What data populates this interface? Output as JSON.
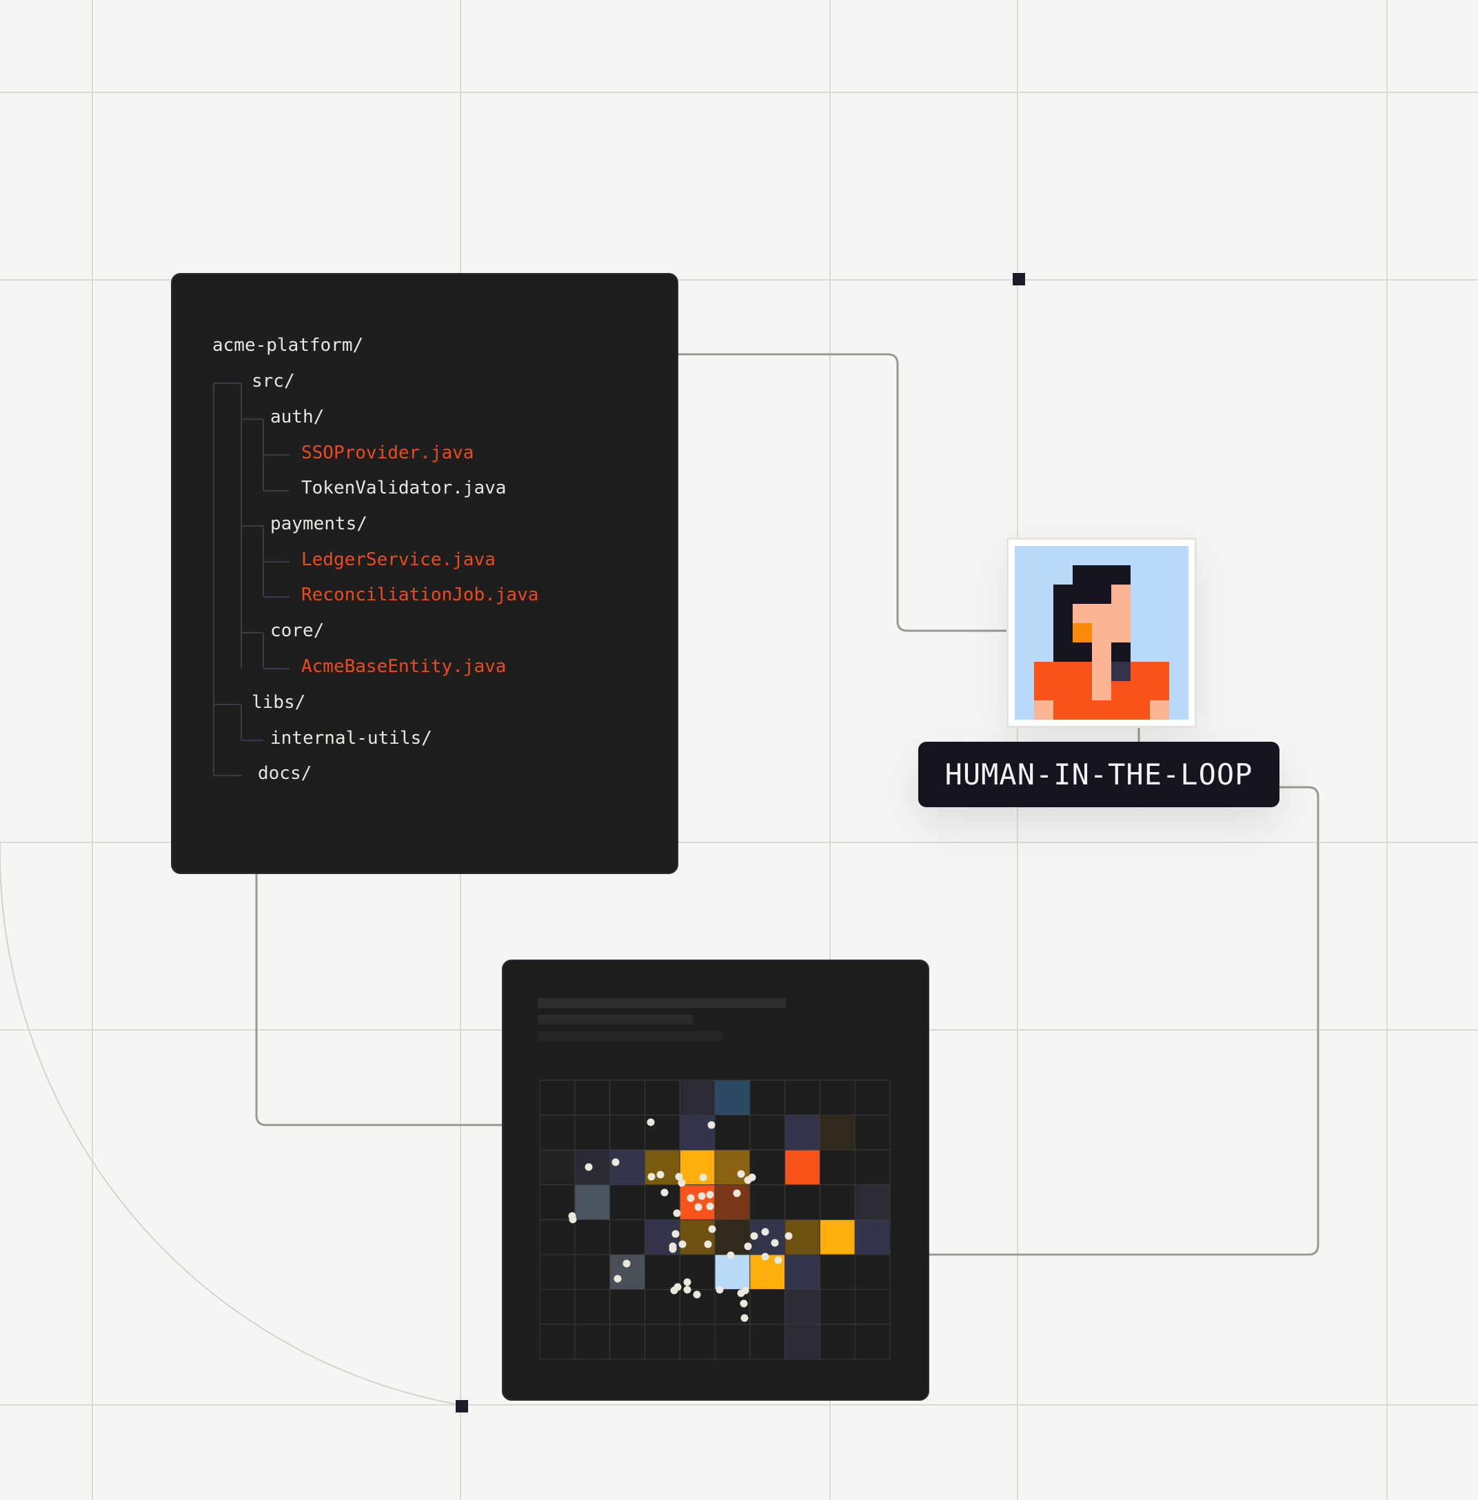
{
  "file_tree": {
    "rows": [
      {
        "label": "acme-platform/",
        "kind": "dir"
      },
      {
        "label": "src/",
        "kind": "dir"
      },
      {
        "label": "auth/",
        "kind": "dir"
      },
      {
        "label": "SSOProvider.java",
        "kind": "highlighted-file"
      },
      {
        "label": "TokenValidator.java",
        "kind": "file"
      },
      {
        "label": "payments/",
        "kind": "dir"
      },
      {
        "label": "LedgerService.java",
        "kind": "highlighted-file"
      },
      {
        "label": "ReconciliationJob.java",
        "kind": "highlighted-file"
      },
      {
        "label": "core/",
        "kind": "dir"
      },
      {
        "label": "AcmeBaseEntity.java",
        "kind": "highlighted-file"
      },
      {
        "label": "libs/",
        "kind": "dir"
      },
      {
        "label": "internal-utils/",
        "kind": "dir"
      },
      {
        "label": "docs/",
        "kind": "dir"
      }
    ]
  },
  "human_node": {
    "label": "HUMAN-IN-THE-LOOP"
  },
  "heatmap_panel": {
    "grid_rows": 8,
    "grid_cols": 10
  },
  "colors": {
    "background": "#f6f5f3",
    "panel": "#1e1e1e",
    "highlight_text": "#ef4a1c",
    "accent_orange": "#f7531a",
    "accent_amber": "#fdae0b",
    "accent_light_blue": "#b9d9fb",
    "label_bg": "#15151f"
  },
  "icons": {
    "avatar": "pixel-person-avatar-icon",
    "markers": "square-marker-icon"
  }
}
